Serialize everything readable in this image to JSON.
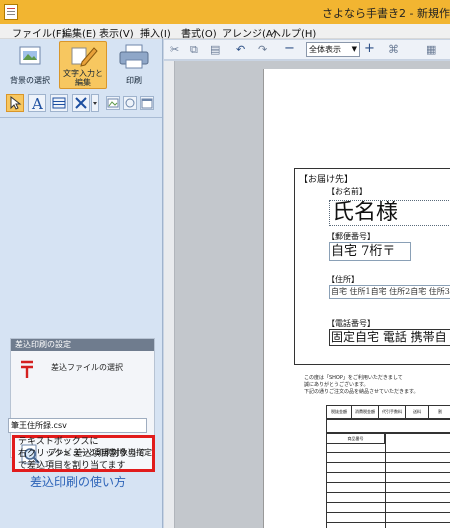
{
  "window": {
    "title": "さよなら手書き2 - 新規作"
  },
  "menu": [
    {
      "label": "ファイル(F)"
    },
    {
      "label": "編集(E)"
    },
    {
      "label": "表示(V)"
    },
    {
      "label": "挿入(I)"
    },
    {
      "label": "書式(O)"
    },
    {
      "label": "アレンジ(A)"
    },
    {
      "label": "ヘルプ(H)"
    }
  ],
  "left_panel": {
    "buttons": [
      {
        "label": "背景の選択"
      },
      {
        "label": "文字入力と編集"
      },
      {
        "label": "印刷"
      }
    ],
    "merge": {
      "title": "差込印刷の設定",
      "file_button": "差込ファイルの選択",
      "file_value": "筆王住所録.csv",
      "preview_button": "プレビューと印刷対象の指定"
    },
    "help_lines": [
      "テキストボックスに",
      "右クリック> 差込項目割り当て",
      "で差込項目を割り当てます"
    ],
    "help_link": "差込印刷の使い方"
  },
  "toolbar": {
    "zoom": "全体表示"
  },
  "document": {
    "header": "【お届け先】",
    "name_label": "【お名前】",
    "name_value": "氏名様",
    "zip_label": "【郵便番号】",
    "zip_value": "自宅 7桁〒",
    "address_label": "【住所】",
    "address_value": "自宅 住所1自宅 住所2自宅 住所3",
    "tel_label": "【電話番号】",
    "tel_value": "固定自宅 電話 携帯自",
    "notes": [
      "この度は「SHOP」をご利用いただきまして",
      "誠にありがとうございます。",
      "下記の通りご注文の品を納品させていただきます。"
    ],
    "summary_headers": [
      "税抜金額",
      "消費税金額",
      "代引手数料",
      "送料",
      "割"
    ],
    "item_header": "商品番号"
  }
}
